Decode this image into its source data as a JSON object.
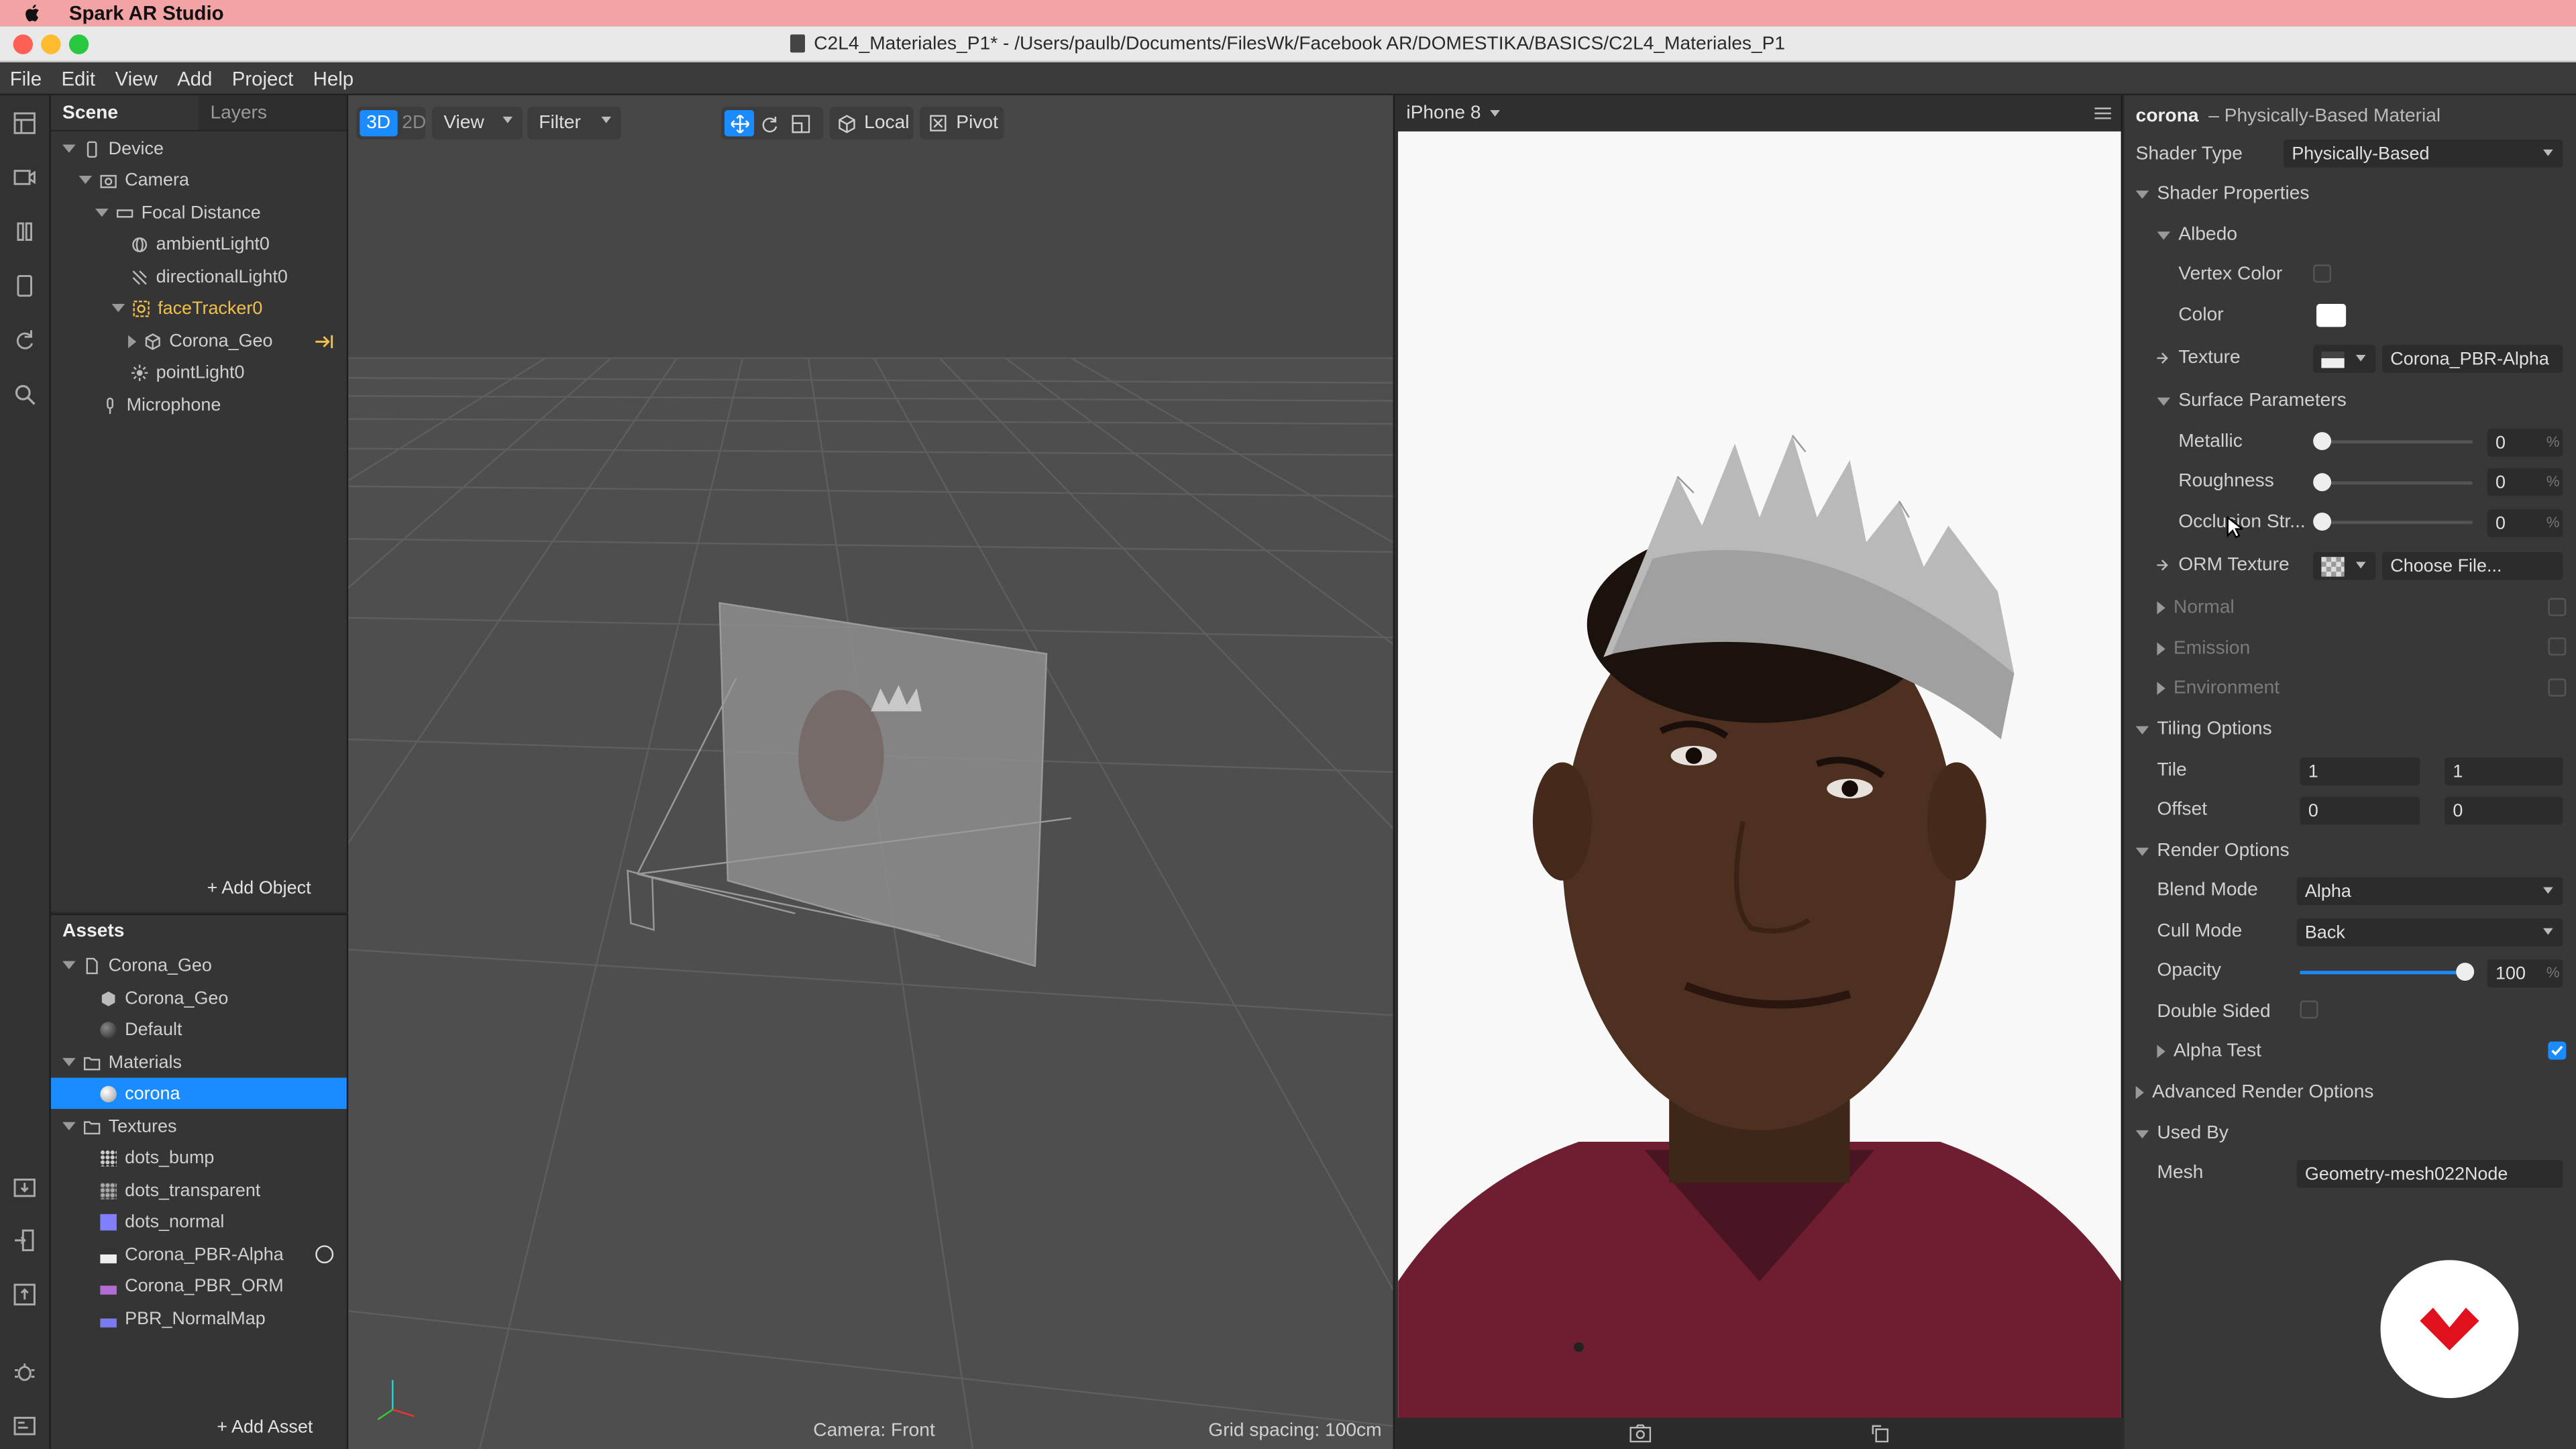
{
  "menubar": {
    "app": "Spark AR Studio"
  },
  "window": {
    "title": "C2L4_Materiales_P1* - /Users/paulb/Documents/FilesWk/Facebook AR/DOMESTIKA/BASICS/C2L4_Materiales_P1"
  },
  "menu": [
    "File",
    "Edit",
    "View",
    "Add",
    "Project",
    "Help"
  ],
  "scene": {
    "tabs": [
      "Scene",
      "Layers"
    ],
    "items": [
      "Device",
      "Camera",
      "Focal Distance",
      "ambientLight0",
      "directionalLight0",
      "faceTracker0",
      "Corona_Geo",
      "pointLight0",
      "Microphone"
    ],
    "add_object": "Add Object"
  },
  "assets": {
    "title": "Assets",
    "items": [
      "Corona_Geo",
      "Corona_Geo",
      "Default",
      "Materials",
      "corona",
      "Textures",
      "dots_bump",
      "dots_transparent",
      "dots_normal",
      "Corona_PBR-Alpha",
      "Corona_PBR_ORM",
      "PBR_NormalMap"
    ],
    "add_asset": "Add Asset"
  },
  "viewport": {
    "mode_3d": "3D",
    "mode_2d": "2D",
    "view": "View",
    "filter": "Filter",
    "local": "Local",
    "pivot": "Pivot",
    "camera_label": "Camera: Front",
    "grid": "Grid spacing: 100cm"
  },
  "simulator": {
    "device": "iPhone 8"
  },
  "inspector": {
    "name": "corona",
    "type": "– Physically-Based Material",
    "shader_type_label": "Shader Type",
    "shader_type": "Physically-Based",
    "shader_props": "Shader Properties",
    "albedo": "Albedo",
    "vertex_color": "Vertex Color",
    "color": "Color",
    "texture": "Texture",
    "texture_value": "Corona_PBR-Alpha",
    "surface": "Surface Parameters",
    "metallic": "Metallic",
    "metallic_value": "0",
    "roughness": "Roughness",
    "roughness_value": "0",
    "occlusion": "Occlusion Str...",
    "occlusion_value": "0",
    "orm": "ORM Texture",
    "orm_value": "Choose File...",
    "normal": "Normal",
    "emission": "Emission",
    "environment": "Environment",
    "tiling": "Tiling Options",
    "tile": "Tile",
    "tile_x": "1",
    "tile_y": "1",
    "offset": "Offset",
    "offset_x": "0",
    "offset_y": "0",
    "render": "Render Options",
    "blend": "Blend Mode",
    "blend_value": "Alpha",
    "cull": "Cull Mode",
    "cull_value": "Back",
    "opacity": "Opacity",
    "opacity_value": "100",
    "opacity_level": 1.0,
    "double_sided": "Double Sided",
    "alpha_test": "Alpha Test",
    "advanced": "Advanced Render Options",
    "used_by": "Used By",
    "mesh": "Mesh",
    "mesh_value": "Geometry-mesh022Node",
    "percent": "%"
  },
  "colors": {
    "accent": "#1a8cff",
    "selected_tree": "#f0c04a",
    "menubar": "#f3a3a3",
    "logo": "#e0101c"
  }
}
